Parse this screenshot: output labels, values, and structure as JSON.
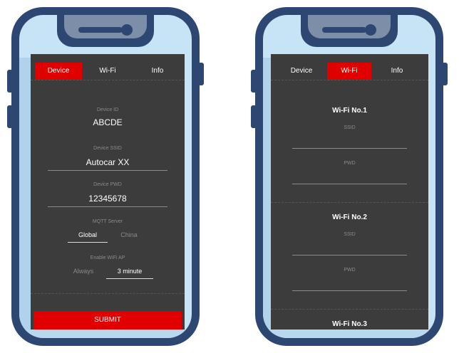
{
  "left_phone": {
    "tabs": [
      {
        "label": "Device",
        "active": true
      },
      {
        "label": "Wi-Fi",
        "active": false
      },
      {
        "label": "Info",
        "active": false
      }
    ],
    "device_id": {
      "label": "Device ID",
      "value": "ABCDE"
    },
    "device_ssid": {
      "label": "Device SSID",
      "value": "Autocar XX"
    },
    "device_pwd": {
      "label": "Device PWD",
      "value": "12345678"
    },
    "mqtt_server": {
      "label": "MQTT Server",
      "options": [
        "Global",
        "China"
      ],
      "selected": "Global"
    },
    "wifi_ap": {
      "label": "Enable WiFi AP",
      "options": [
        "Always",
        "3 minute"
      ],
      "selected": "3 minute"
    },
    "submit_label": "SUBMIT"
  },
  "right_phone": {
    "tabs": [
      {
        "label": "Device",
        "active": false
      },
      {
        "label": "Wi-Fi",
        "active": true
      },
      {
        "label": "Info",
        "active": false
      }
    ],
    "wifi_sections": [
      {
        "title": "Wi-Fi No.1",
        "ssid_placeholder": "SSID",
        "pwd_placeholder": "PWD"
      },
      {
        "title": "Wi-Fi No.2",
        "ssid_placeholder": "SSID",
        "pwd_placeholder": "PWD"
      },
      {
        "title": "Wi-Fi No.3"
      }
    ]
  },
  "colors": {
    "accent": "#e00000",
    "phone_frame": "#2d4672",
    "bezel": "#c6e4f6",
    "screen": "#3c3c3c"
  }
}
